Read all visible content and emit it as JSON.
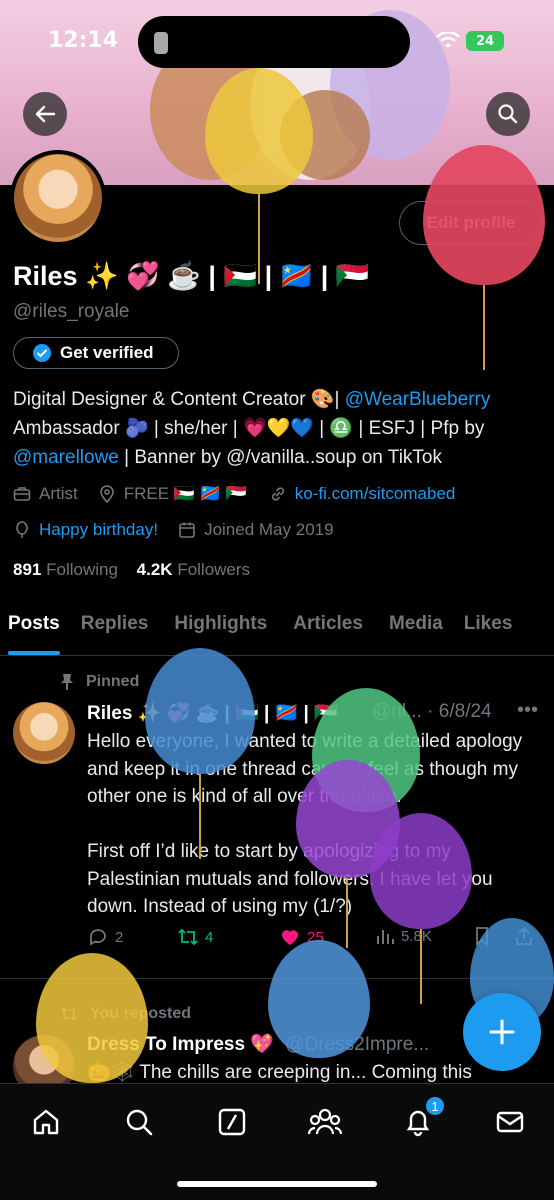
{
  "status": {
    "time": "12:14",
    "battery": "24"
  },
  "profile": {
    "name": "Riles ✨ 💞 ☕️ | 🇵🇸 | 🇨🇩 | 🇸🇩",
    "handle": "@riles_royale",
    "edit_label": "Edit profile",
    "verify_label": "Get verified",
    "bio": {
      "line1_text": "Digital Designer & Content Creator 🎨| ",
      "line1_link": "@WearBlueberry",
      "line2": "Ambassador 🫐 | she/her | 💗💛💙 | ♎️ | ESFJ | Pfp by",
      "line3_link": "@marellowe",
      "line3_text": " | Banner by @/vanilla..soup on TikTok"
    },
    "category": "Artist",
    "location": "FREE 🇵🇸 🇨🇩 🇸🇩",
    "website": "ko-fi.com/sitcomabed",
    "birthday": "Happy birthday!",
    "joined": "Joined May 2019",
    "following_count": "891",
    "following_label": "Following",
    "followers_count": "4.2K",
    "followers_label": "Followers"
  },
  "tabs": [
    "Posts",
    "Replies",
    "Highlights",
    "Articles",
    "Media",
    "Likes"
  ],
  "pinned_post": {
    "pinned_label": "Pinned",
    "author": "Riles ✨ 💞 ☕️ | 🇵🇸 | 🇨🇩 | 🇸🇩",
    "meta": "@ril... · 6/8/24",
    "text": "Hello everyone, I wanted to write a detailed apology and keep it in one thread cause I feel as though my other one is kind of all over the place.\n\nFirst off I’d like to start by apologizing to my Palestinian mutuals and followers. I have let you down. Instead of using my (1/?)",
    "replies": "2",
    "reposts": "4",
    "likes": "25",
    "views": "5.8K"
  },
  "second_post": {
    "repost_label": "You reposted",
    "author": "Dress To Impress 💖",
    "meta": "@Dress2Impre...",
    "text": "🎃🕸️ The chills are creeping in... Coming this"
  },
  "nav": {
    "notification_count": "1"
  },
  "colors": {
    "accent": "#1d9bf0",
    "like": "#f91880",
    "repost": "#00ba7c"
  }
}
